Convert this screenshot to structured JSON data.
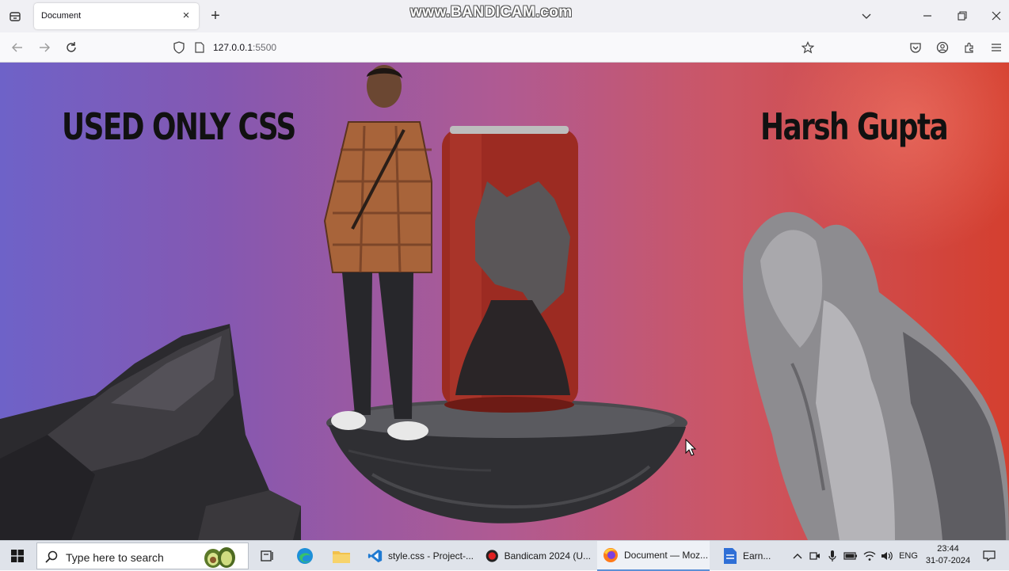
{
  "browser": {
    "tab_title": "Document",
    "url_host": "127.0.0.1",
    "url_port": ":5500",
    "watermark": "www.BANDICAM.com"
  },
  "page": {
    "heading_left": "USED ONLY CSS",
    "heading_right": "Harsh Gupta"
  },
  "taskbar": {
    "search_placeholder": "Type here to search",
    "apps": [
      {
        "label": "style.css - Project-..."
      },
      {
        "label": "Bandicam 2024 (U..."
      },
      {
        "label": "Document — Moz..."
      },
      {
        "label": "Earn..."
      }
    ],
    "language": "ENG",
    "time": "23:44",
    "date": "31-07-2024"
  },
  "colors": {
    "accent": "#5b8fd6",
    "page_left": "#6e62c8",
    "page_right": "#d43f2f"
  }
}
